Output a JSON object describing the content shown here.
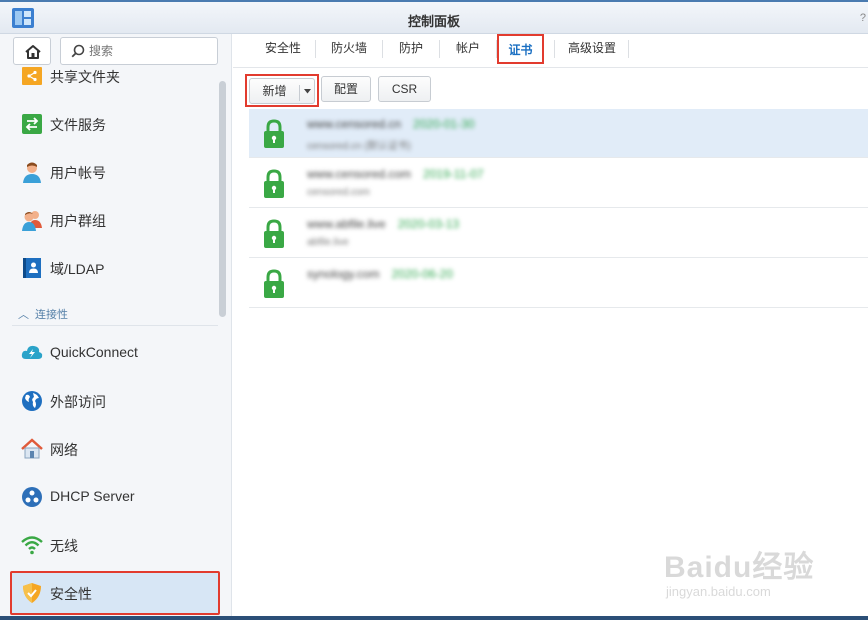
{
  "window": {
    "title": "控制面板",
    "help": "?"
  },
  "sidebar": {
    "search_placeholder": "搜索",
    "items": [
      {
        "label": "共享文件夹",
        "icon": "shared-folder-icon"
      },
      {
        "label": "文件服务",
        "icon": "file-services-icon"
      },
      {
        "label": "用户帐号",
        "icon": "user-icon"
      },
      {
        "label": "用户群组",
        "icon": "group-icon"
      },
      {
        "label": "域/LDAP",
        "icon": "domain-ldap-icon"
      },
      {
        "label": "QuickConnect",
        "icon": "quickconnect-icon"
      },
      {
        "label": "外部访问",
        "icon": "external-access-icon"
      },
      {
        "label": "网络",
        "icon": "network-icon"
      },
      {
        "label": "DHCP Server",
        "icon": "dhcp-icon"
      },
      {
        "label": "无线",
        "icon": "wifi-icon"
      },
      {
        "label": "安全性",
        "icon": "security-shield-icon"
      }
    ],
    "section_connectivity": "连接性",
    "section_toggle": "︿"
  },
  "tabs": [
    {
      "label": "安全性"
    },
    {
      "label": "防火墙"
    },
    {
      "label": "防护"
    },
    {
      "label": "帐户"
    },
    {
      "label": "证书",
      "active": true
    },
    {
      "label": "高级设置"
    }
  ],
  "toolbar": {
    "add": "新增",
    "configure": "配置",
    "csr": "CSR"
  },
  "certificates": [
    {
      "name": "www.censored.cn",
      "date": "2020-01-30",
      "sub": "censored.cn (默认证书)"
    },
    {
      "name": "www.censored.com",
      "date": "2019-11-07",
      "sub": "censored.com"
    },
    {
      "name": "www.abfile.live",
      "date": "2020-03-13",
      "sub": "abfile.live"
    },
    {
      "name": "synology.com",
      "date": "2020-06-20",
      "sub": ""
    }
  ],
  "watermark": {
    "brand": "Baidu经验",
    "url": "jingyan.baidu.com"
  },
  "colors": {
    "accent": "#1a6fc2",
    "highlight": "#e23b2e",
    "lock": "#3aa845",
    "selected_row": "#e1ecf8"
  }
}
